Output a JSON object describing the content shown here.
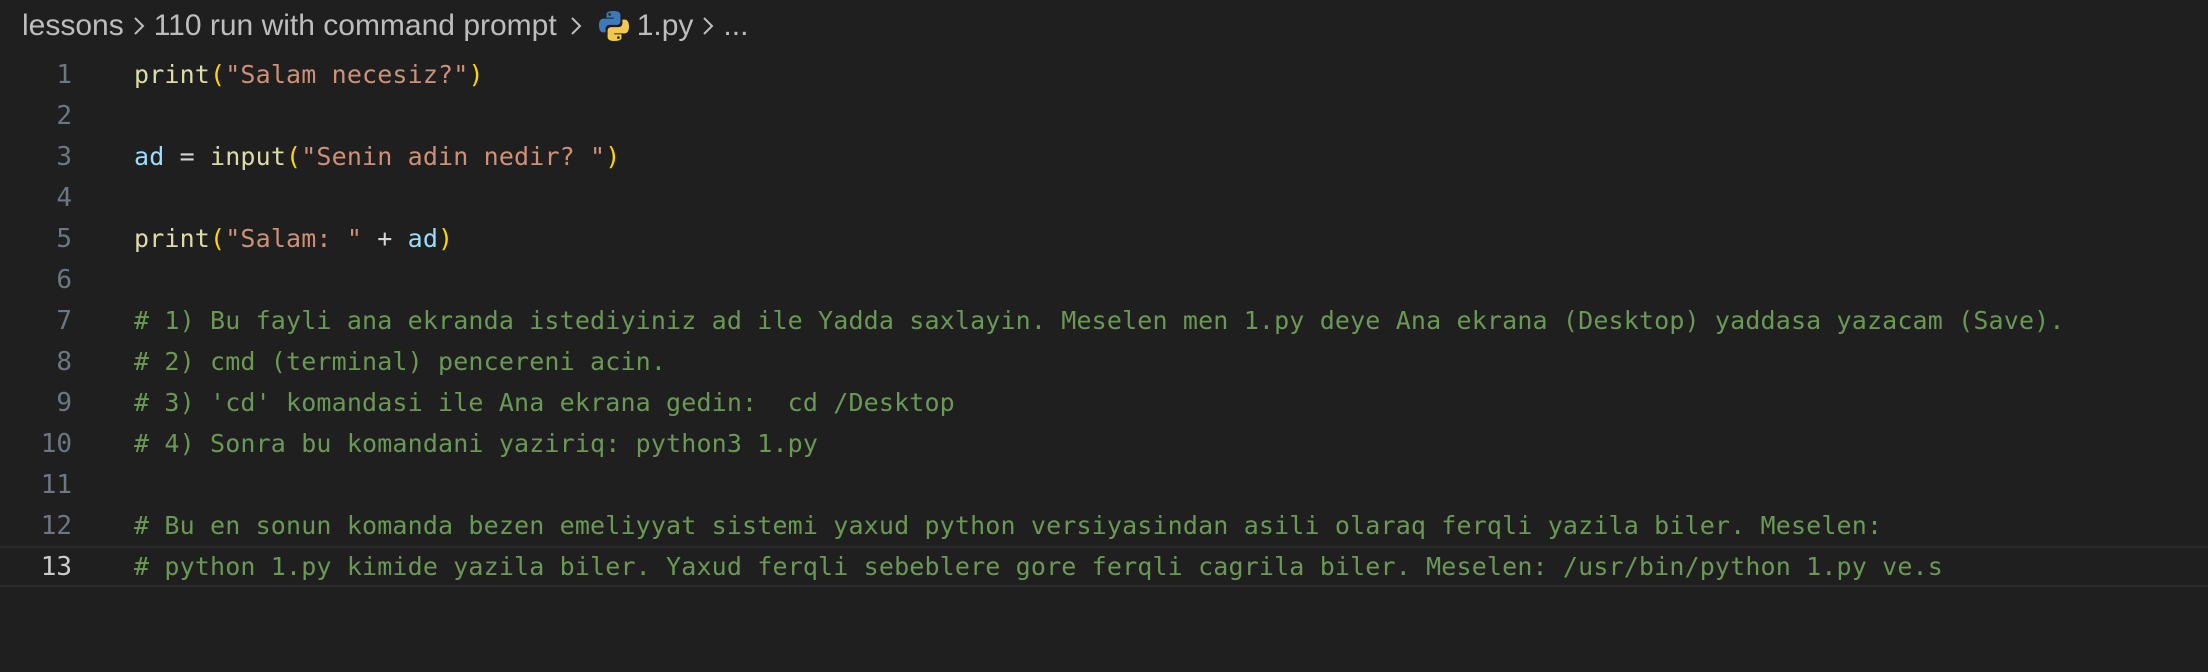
{
  "breadcrumb": {
    "folder1": "lessons",
    "folder2": "110 run with command prompt",
    "file": "1.py",
    "more": "..."
  },
  "editor": {
    "active_line": 13,
    "lines": [
      {
        "num": "1",
        "tokens": [
          {
            "t": "print",
            "c": "fn"
          },
          {
            "t": "(",
            "c": "paren"
          },
          {
            "t": "\"Salam necesiz?\"",
            "c": "str"
          },
          {
            "t": ")",
            "c": "paren"
          }
        ]
      },
      {
        "num": "2",
        "tokens": []
      },
      {
        "num": "3",
        "tokens": [
          {
            "t": "ad",
            "c": "var"
          },
          {
            "t": " = ",
            "c": "op"
          },
          {
            "t": "input",
            "c": "fn"
          },
          {
            "t": "(",
            "c": "paren"
          },
          {
            "t": "\"Senin adin nedir? \"",
            "c": "str"
          },
          {
            "t": ")",
            "c": "paren"
          }
        ]
      },
      {
        "num": "4",
        "tokens": []
      },
      {
        "num": "5",
        "tokens": [
          {
            "t": "print",
            "c": "fn"
          },
          {
            "t": "(",
            "c": "paren"
          },
          {
            "t": "\"Salam: \"",
            "c": "str"
          },
          {
            "t": " + ",
            "c": "op"
          },
          {
            "t": "ad",
            "c": "var"
          },
          {
            "t": ")",
            "c": "paren"
          }
        ]
      },
      {
        "num": "6",
        "tokens": []
      },
      {
        "num": "7",
        "tokens": [
          {
            "t": "# 1) Bu fayli ana ekranda istediyiniz ad ile Yadda saxlayin. Meselen men 1.py deye Ana ekrana (Desktop) yaddasa yazacam (Save).",
            "c": "cmt"
          }
        ]
      },
      {
        "num": "8",
        "tokens": [
          {
            "t": "# 2) cmd (terminal) pencereni acin.",
            "c": "cmt"
          }
        ]
      },
      {
        "num": "9",
        "tokens": [
          {
            "t": "# 3) 'cd' komandasi ile Ana ekrana gedin:  cd /Desktop",
            "c": "cmt"
          }
        ]
      },
      {
        "num": "10",
        "tokens": [
          {
            "t": "# 4) Sonra bu komandani yaziriq: python3 1.py",
            "c": "cmt"
          }
        ]
      },
      {
        "num": "11",
        "tokens": []
      },
      {
        "num": "12",
        "tokens": [
          {
            "t": "# Bu en sonun komanda bezen emeliyyat sistemi yaxud python versiyasindan asili olaraq ferqli yazila biler. Meselen:",
            "c": "cmt"
          }
        ]
      },
      {
        "num": "13",
        "tokens": [
          {
            "t": "# python 1.py kimide yazila biler. Yaxud ferqli sebeblere gore ferqli cagrila biler. Meselen: /usr/bin/python 1.py ve.s",
            "c": "cmt"
          }
        ]
      }
    ]
  }
}
